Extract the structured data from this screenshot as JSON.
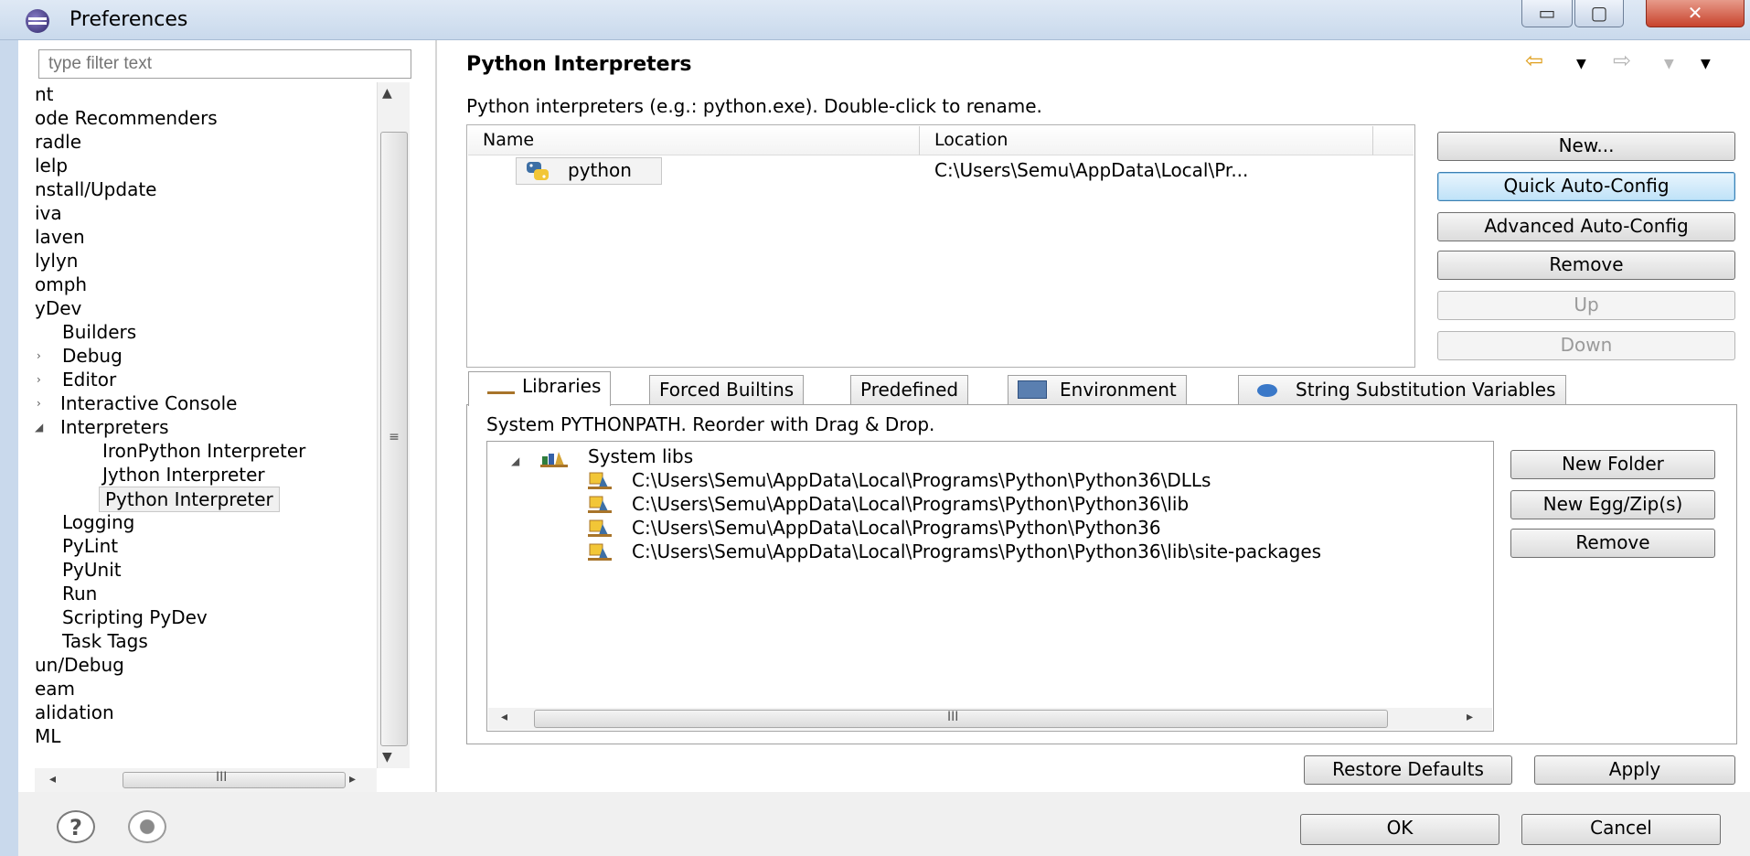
{
  "window": {
    "title": "Preferences",
    "min_glyph": "▭",
    "max_glyph": "▢",
    "close_glyph": "✕"
  },
  "sidebar": {
    "filter_placeholder": "type filter text",
    "items": [
      {
        "label": "nt"
      },
      {
        "label": "ode Recommenders"
      },
      {
        "label": "radle"
      },
      {
        "label": "lelp"
      },
      {
        "label": "nstall/Update"
      },
      {
        "label": "iva"
      },
      {
        "label": "laven"
      },
      {
        "label": "lylyn"
      },
      {
        "label": "omph"
      },
      {
        "label": "yDev"
      },
      {
        "label": "Builders"
      },
      {
        "label": "Debug"
      },
      {
        "label": "Editor"
      },
      {
        "label": "Interactive Console"
      },
      {
        "label": "Interpreters"
      },
      {
        "label": "IronPython Interpreter"
      },
      {
        "label": "Jython Interpreter"
      },
      {
        "label": "Python Interpreter",
        "selected": true
      },
      {
        "label": "Logging"
      },
      {
        "label": "PyLint"
      },
      {
        "label": "PyUnit"
      },
      {
        "label": "Run"
      },
      {
        "label": "Scripting PyDev"
      },
      {
        "label": "Task Tags"
      },
      {
        "label": "un/Debug"
      },
      {
        "label": "eam"
      },
      {
        "label": "alidation"
      },
      {
        "label": "ML"
      }
    ],
    "scroll_grip": "≡",
    "hscroll_grip": "III"
  },
  "main": {
    "title": "Python Interpreters",
    "description": "Python interpreters (e.g.: python.exe).   Double-click to rename.",
    "table": {
      "columns": [
        "Name",
        "Location"
      ],
      "rows": [
        {
          "name": "python",
          "location": "C:\\Users\\Semu\\AppData\\Local\\Pr..."
        }
      ]
    },
    "buttons": {
      "new": "New...",
      "quick": "Quick Auto-Config",
      "advanced": "Advanced Auto-Config",
      "remove": "Remove",
      "up": "Up",
      "down": "Down"
    },
    "tabs": [
      "Libraries",
      "Forced Builtins",
      "Predefined",
      "Environment",
      "String Substitution Variables"
    ],
    "libraries": {
      "description": "System PYTHONPATH.   Reorder with Drag & Drop.",
      "root": "System libs",
      "paths": [
        "C:\\Users\\Semu\\AppData\\Local\\Programs\\Python\\Python36\\DLLs",
        "C:\\Users\\Semu\\AppData\\Local\\Programs\\Python\\Python36\\lib",
        "C:\\Users\\Semu\\AppData\\Local\\Programs\\Python\\Python36",
        "C:\\Users\\Semu\\AppData\\Local\\Programs\\Python\\Python36\\lib\\site-packages"
      ],
      "scroll_grip": "III",
      "buttons": {
        "new_folder": "New Folder",
        "new_egg": "New Egg/Zip(s)",
        "remove": "Remove"
      }
    },
    "restore_defaults": "Restore Defaults",
    "apply": "Apply"
  },
  "footer": {
    "help_glyph": "?",
    "ok": "OK",
    "cancel": "Cancel"
  },
  "colors": {
    "accent_focus": "#3c7fb1",
    "python_blue": "#3d6fa5",
    "python_yellow": "#f2c637",
    "library_brown": "#a8742a"
  }
}
